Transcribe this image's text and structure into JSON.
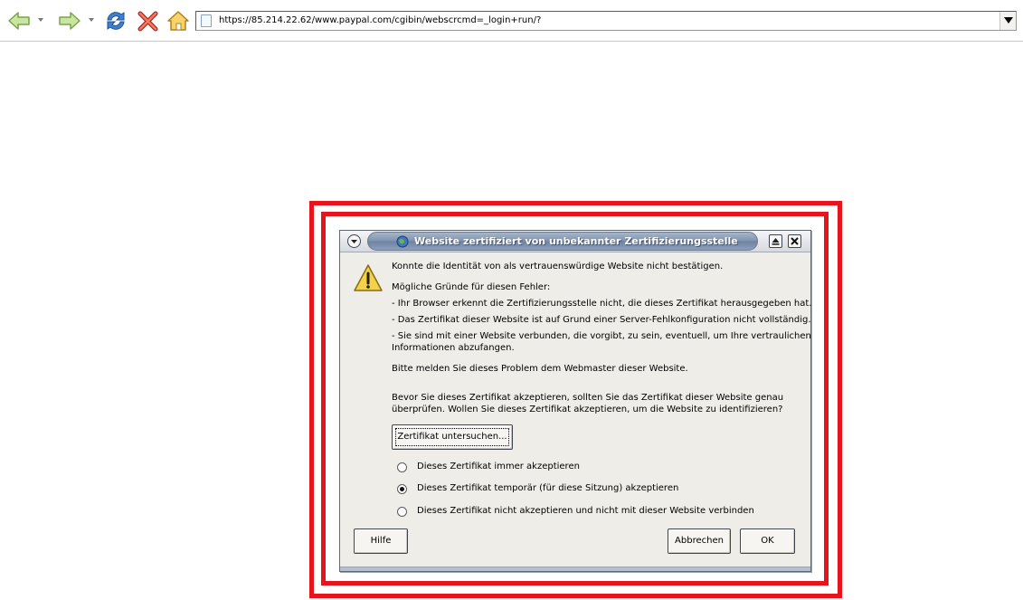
{
  "browser": {
    "url": "https://85.214.22.62/www.paypal.com/cgibin/webscrcmd=_login+run/?"
  },
  "dialog": {
    "title": "Website zertifiziert von unbekannter Zertifizierungsstelle",
    "line1": "Konnte die Identität von als vertrauenswürdige Website nicht bestätigen.",
    "reasons_heading": "Mögliche Gründe für diesen Fehler:",
    "reason1": "- Ihr Browser erkennt die Zertifizierungsstelle nicht, die dieses Zertifikat herausgegeben hat.",
    "reason2": "- Das Zertifikat dieser Website ist auf Grund einer Server-Fehlkonfiguration nicht vollständig.",
    "reason3_line1": "- Sie sind mit einer Website verbunden, die vorgibt, zu sein, eventuell, um Ihre vertraulichen",
    "reason3_line2": "Informationen abzufangen.",
    "report": "Bitte melden Sie dieses Problem dem Webmaster dieser Website.",
    "advice_line1": "Bevor Sie dieses Zertifikat akzeptieren, sollten Sie das Zertifikat dieser Website genau",
    "advice_line2": "überprüfen. Wollen Sie dieses Zertifikat akzeptieren, um die Website zu identifizieren?",
    "examine_button": "Zertifikat untersuchen...",
    "options": [
      {
        "label": "Dieses Zertifikat immer akzeptieren",
        "checked": false
      },
      {
        "label": "Dieses Zertifikat temporär (für diese Sitzung) akzeptieren",
        "checked": true
      },
      {
        "label": "Dieses Zertifikat nicht akzeptieren und nicht mit dieser Website verbinden",
        "checked": false
      }
    ],
    "help_button": "Hilfe",
    "cancel_button": "Abbrechen",
    "ok_button": "OK"
  },
  "colors": {
    "annotation_frame": "#e8141b",
    "title_bar": "#7f92ad",
    "dialog_bg": "#eeede8"
  }
}
